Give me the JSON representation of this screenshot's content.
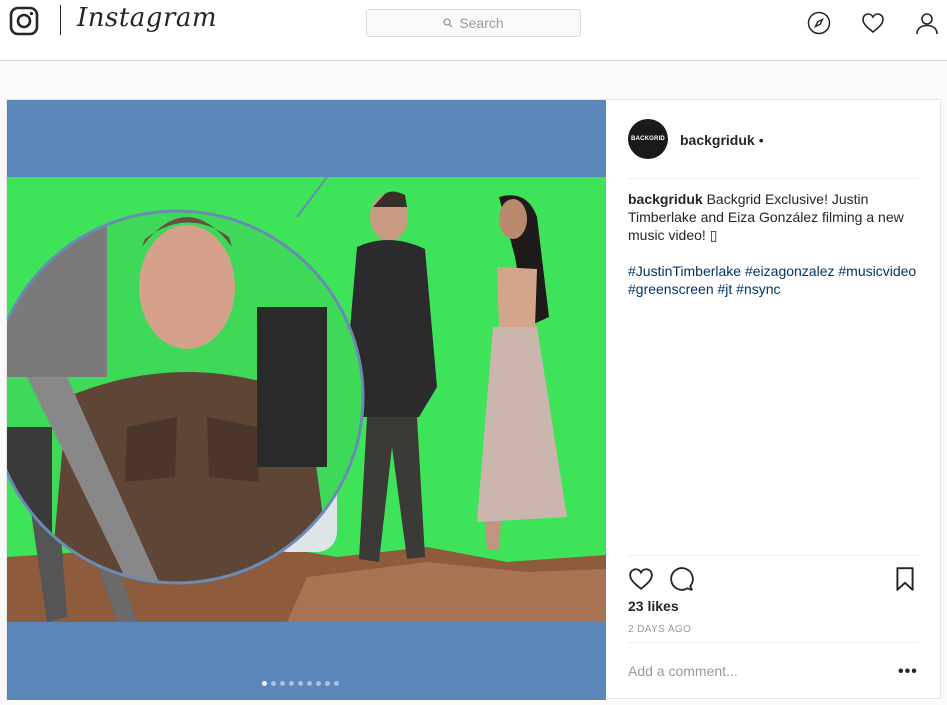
{
  "header": {
    "brand": "Instagram",
    "search_placeholder": "Search"
  },
  "post": {
    "username": "backgriduk",
    "separator": "•",
    "avatar_text": "BACKGRID",
    "caption_user": "backgriduk",
    "caption_text": "Backgrid Exclusive! Justin Timberlake and Eiza González filming a new music video! ▯",
    "hashtags": "#JustinTimberlake #eizagonzalez #musicvideo #greenscreen #jt #nsync",
    "likes": "23 likes",
    "time": "2 DAYS AGO",
    "comment_placeholder": "Add a comment...",
    "more": "•••",
    "carousel_total": 9,
    "carousel_index": 1
  },
  "colors": {
    "media_bg": "#5b86ba",
    "green_screen": "#3fe35a",
    "link": "#003569"
  }
}
